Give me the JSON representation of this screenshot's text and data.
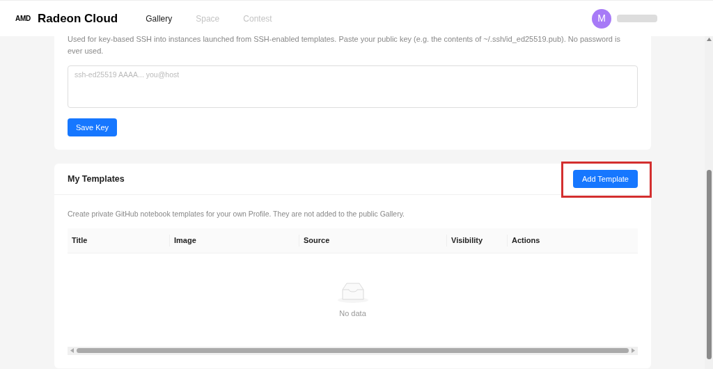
{
  "brand": {
    "logo": "AMD",
    "title": "Radeon Cloud"
  },
  "nav": [
    {
      "label": "Gallery",
      "selected": true
    },
    {
      "label": "Space",
      "selected": false
    },
    {
      "label": "Contest",
      "selected": false
    }
  ],
  "user": {
    "initial": "M"
  },
  "ssh_key": {
    "description": "Used for key-based SSH into instances launched from SSH-enabled templates. Paste your public key (e.g. the contents of ~/.ssh/id_ed25519.pub). No password is ever used.",
    "placeholder": "ssh-ed25519 AAAA... you@host",
    "save_button": "Save Key"
  },
  "templates": {
    "title": "My Templates",
    "add_button": "Add Template",
    "description": "Create private GitHub notebook templates for your own Profile. They are not added to the public Gallery.",
    "table": {
      "columns": [
        "Title",
        "Image",
        "Source",
        "Visibility",
        "Actions"
      ],
      "empty_text": "No data"
    }
  }
}
